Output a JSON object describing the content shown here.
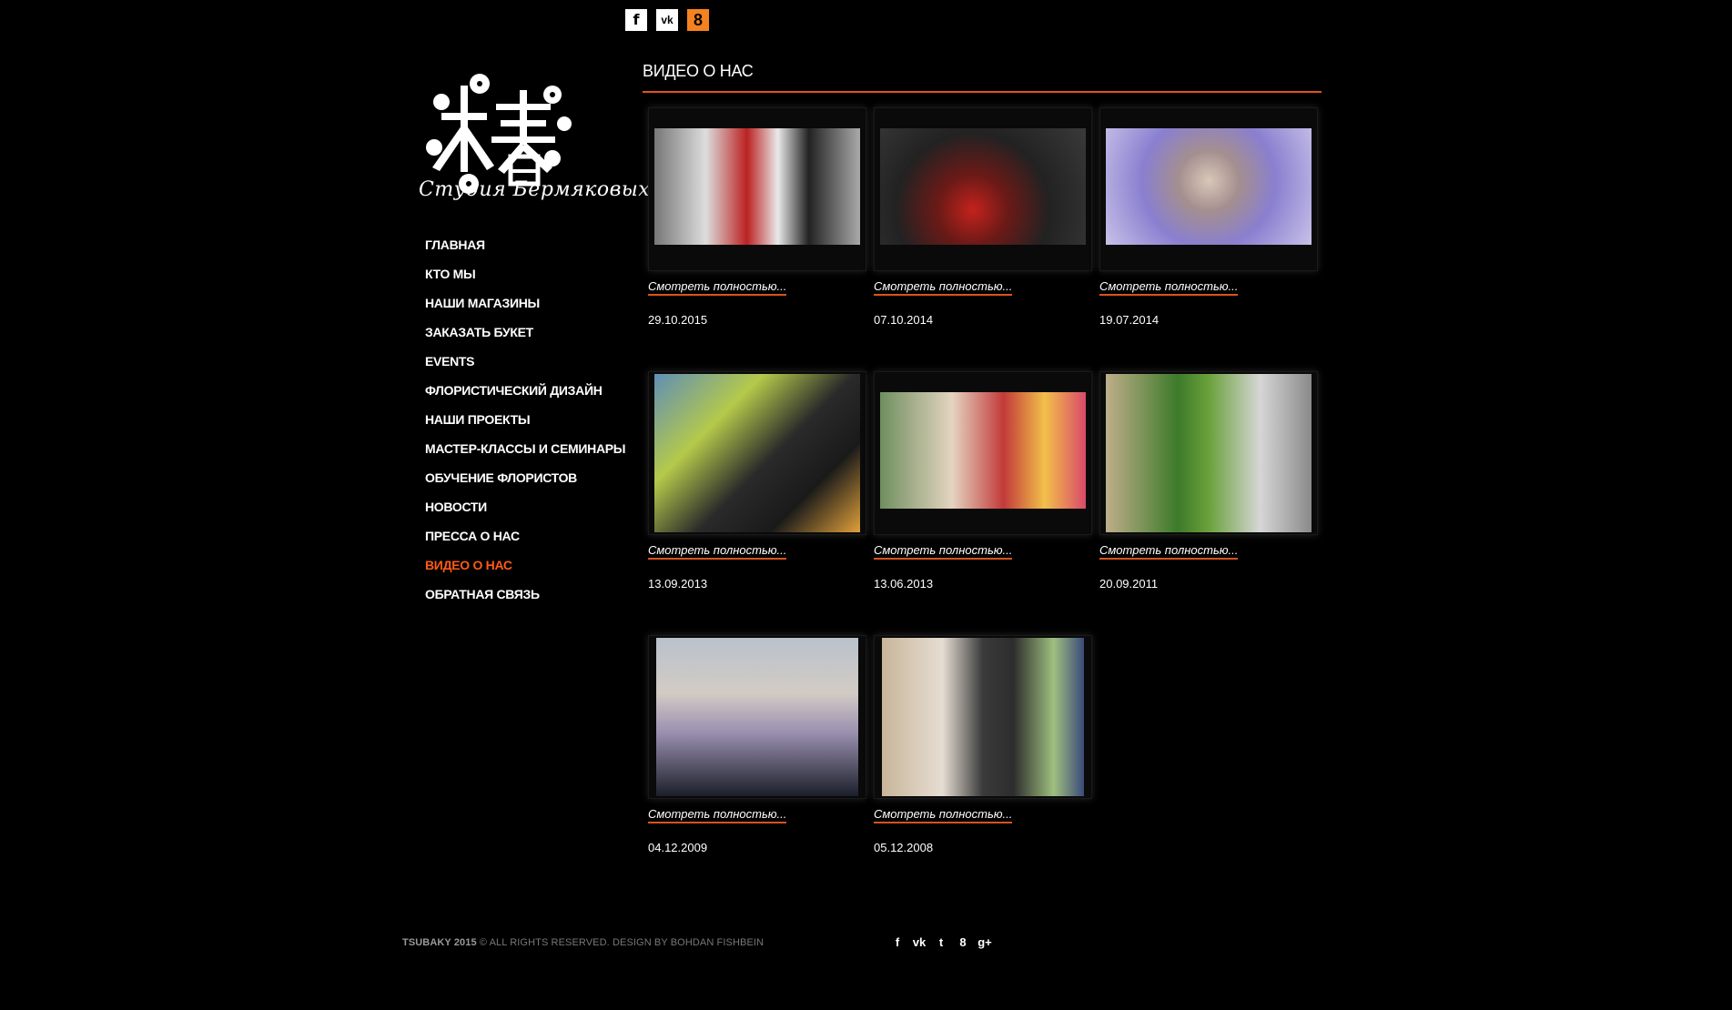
{
  "top_social": [
    {
      "icon": "facebook-icon",
      "glyph": "f"
    },
    {
      "icon": "vk-icon",
      "glyph": "vk"
    },
    {
      "icon": "odnoklassniki-icon",
      "glyph": "8"
    }
  ],
  "logo": {
    "caption": "Студия Бермяковых"
  },
  "nav": {
    "items": [
      {
        "label": "ГЛАВНАЯ"
      },
      {
        "label": "КТО МЫ"
      },
      {
        "label": "НАШИ МАГАЗИНЫ"
      },
      {
        "label": "ЗАКАЗАТЬ БУКЕТ"
      },
      {
        "label": "EVENTS"
      },
      {
        "label": "ФЛОРИСТИЧЕСКИЙ ДИЗАЙН"
      },
      {
        "label": "НАШИ ПРОЕКТЫ"
      },
      {
        "label": "МАСТЕР-КЛАССЫ И СЕМИНАРЫ"
      },
      {
        "label": "ОБУЧЕНИЕ ФЛОРИСТОВ"
      },
      {
        "label": "НОВОСТИ"
      },
      {
        "label": "ПРЕССА О НАС"
      },
      {
        "label": "ВИДЕО О НАС",
        "active": true
      },
      {
        "label": "ОБРАТНАЯ СВЯЗЬ"
      }
    ]
  },
  "main": {
    "title": "ВИДЕО О НАС"
  },
  "videos": [
    {
      "link": "Смотреть полностью...",
      "date": "29.10.2015"
    },
    {
      "link": "Смотреть полностью...",
      "date": "07.10.2014"
    },
    {
      "link": "Смотреть полностью...",
      "date": "19.07.2014"
    },
    {
      "link": "Смотреть полностью...",
      "date": "13.09.2013"
    },
    {
      "link": "Смотреть полностью...",
      "date": "13.06.2013"
    },
    {
      "link": "Смотреть полностью...",
      "date": "20.09.2011"
    },
    {
      "link": "Смотреть полностью...",
      "date": "04.12.2009"
    },
    {
      "link": "Смотреть полностью...",
      "date": "05.12.2008"
    }
  ],
  "footer": {
    "brand": "TSUBAKY 2015",
    "text": "© ALL RIGHTS RESERVED. DESIGN BY BOHDAN FISHBEIN",
    "social": [
      {
        "icon": "facebook-icon",
        "glyph": "f"
      },
      {
        "icon": "vk-icon",
        "glyph": "vk"
      },
      {
        "icon": "twitter-icon",
        "glyph": "t"
      },
      {
        "icon": "odnoklassniki-icon",
        "glyph": "8"
      },
      {
        "icon": "google-plus-icon",
        "glyph": "g+"
      }
    ]
  },
  "colors": {
    "accent": "#e0531c",
    "active_nav": "#ff5a16",
    "background": "#000000"
  }
}
